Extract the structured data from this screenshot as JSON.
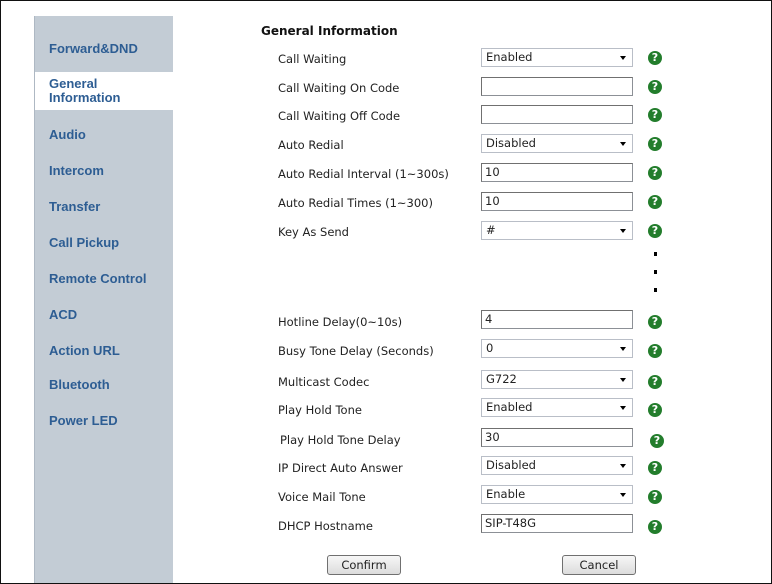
{
  "sidebar": {
    "items": [
      {
        "label": "Forward&DND"
      },
      {
        "label": "General Information",
        "active": true
      },
      {
        "label": "Audio"
      },
      {
        "label": "Intercom"
      },
      {
        "label": "Transfer"
      },
      {
        "label": "Call Pickup"
      },
      {
        "label": "Remote Control"
      },
      {
        "label": "ACD"
      },
      {
        "label": "Action URL"
      },
      {
        "label": "Bluetooth"
      },
      {
        "label": "Power LED"
      }
    ]
  },
  "section_title": "General Information",
  "help_glyph": "?",
  "fields": {
    "call_waiting": {
      "label": "Call Waiting",
      "value": "Enabled"
    },
    "cw_on_code": {
      "label": "Call Waiting On Code",
      "value": ""
    },
    "cw_off_code": {
      "label": "Call Waiting Off Code",
      "value": ""
    },
    "auto_redial": {
      "label": "Auto Redial",
      "value": "Disabled"
    },
    "auto_redial_interval": {
      "label": "Auto Redial Interval (1~300s)",
      "value": "10"
    },
    "auto_redial_times": {
      "label": "Auto Redial Times (1~300)",
      "value": "10"
    },
    "key_as_send": {
      "label": "Key As Send",
      "value": "#"
    },
    "hotline_delay": {
      "label": "Hotline Delay(0~10s)",
      "value": "4"
    },
    "busy_tone_delay": {
      "label": "Busy Tone Delay (Seconds)",
      "value": "0"
    },
    "multicast_codec": {
      "label": "Multicast Codec",
      "value": "G722"
    },
    "play_hold_tone": {
      "label": "Play Hold Tone",
      "value": "Enabled"
    },
    "play_hold_tone_delay": {
      "label": "Play Hold Tone Delay",
      "value": "30"
    },
    "ip_direct_auto_answer": {
      "label": "IP Direct Auto Answer",
      "value": "Disabled"
    },
    "voice_mail_tone": {
      "label": "Voice Mail Tone",
      "value": "Enable"
    },
    "dhcp_hostname": {
      "label": "DHCP Hostname",
      "value": "SIP-T48G"
    }
  },
  "buttons": {
    "confirm": "Confirm",
    "cancel": "Cancel"
  },
  "colors": {
    "sidebar_bg": "#c3ccd5",
    "nav_text": "#2d5d93",
    "help_icon": "#237d2c"
  }
}
